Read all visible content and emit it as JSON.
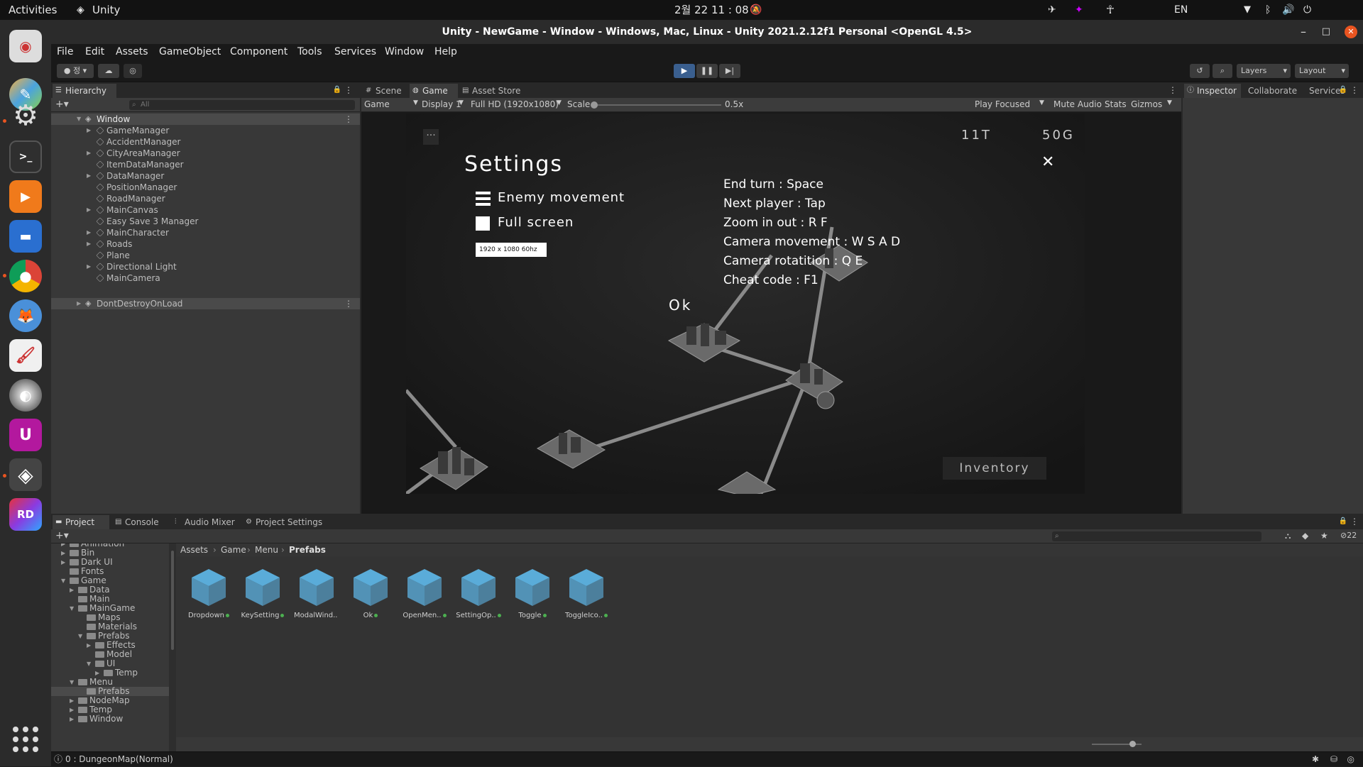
{
  "topbar": {
    "activities": "Activities",
    "app": "Unity",
    "clock": "2월 22  11 : 08",
    "lang": "EN"
  },
  "window": {
    "title": "Unity - NewGame - Window - Windows, Mac, Linux - Unity 2021.2.12f1 Personal <OpenGL 4.5>",
    "min": "–",
    "max": "□",
    "close": "✕"
  },
  "menu": [
    "File",
    "Edit",
    "Assets",
    "GameObject",
    "Component",
    "Tools",
    "Services",
    "Window",
    "Help"
  ],
  "toolbar": {
    "account": "정",
    "layers": "Layers",
    "layout": "Layout"
  },
  "hierarchy": {
    "tab": "Hierarchy",
    "search_placeholder": "All",
    "root": "Window",
    "items": [
      "GameManager",
      "AccidentManager",
      "CityAreaManager",
      "ItemDataManager",
      "DataManager",
      "PositionManager",
      "RoadManager",
      "MainCanvas",
      "Easy Save 3 Manager",
      "MainCharacter",
      "Roads",
      "Plane",
      "Directional Light",
      "MainCamera"
    ],
    "dont_destroy": "DontDestroyOnLoad"
  },
  "center_tabs": [
    "Scene",
    "Game",
    "Asset Store"
  ],
  "game_toolbar": {
    "view": "Game",
    "display": "Display 1",
    "resolution": "Full HD (1920x1080)",
    "scale_label": "Scale",
    "scale_value": "0.5x",
    "play_focused": "Play Focused",
    "mute": "Mute Audio",
    "stats": "Stats",
    "gizmos": "Gizmos"
  },
  "game": {
    "dots": "···",
    "turn": "11T",
    "gold": "50G",
    "title": "Settings",
    "close": "✕",
    "toggle_enemy": "Enemy movement",
    "toggle_full": "Full screen",
    "resolution": "1920 x 1080 60hz",
    "ok": "Ok",
    "keys": [
      "End turn : Space",
      "Next player : Tap",
      "Zoom in out : R F",
      "Camera movement : W S A D",
      "Camera rotatition : Q E",
      "Cheat code : F1"
    ],
    "inventory": "Inventory"
  },
  "right_tabs": [
    "Inspector",
    "Collaborate",
    "Services"
  ],
  "bottom_tabs": [
    "Project",
    "Console",
    "Audio Mixer",
    "Project Settings"
  ],
  "badge": "22",
  "project_tree": [
    {
      "name": "Animation",
      "d": 0,
      "a": "▶"
    },
    {
      "name": "Bin",
      "d": 0,
      "a": "▶"
    },
    {
      "name": "Dark UI",
      "d": 0,
      "a": "▶"
    },
    {
      "name": "Fonts",
      "d": 0,
      "a": ""
    },
    {
      "name": "Game",
      "d": 0,
      "a": "▼"
    },
    {
      "name": "Data",
      "d": 1,
      "a": "▶"
    },
    {
      "name": "Main",
      "d": 1,
      "a": ""
    },
    {
      "name": "MainGame",
      "d": 1,
      "a": "▼"
    },
    {
      "name": "Maps",
      "d": 2,
      "a": ""
    },
    {
      "name": "Materials",
      "d": 2,
      "a": ""
    },
    {
      "name": "Prefabs",
      "d": 2,
      "a": "▼"
    },
    {
      "name": "Effects",
      "d": 3,
      "a": "▶"
    },
    {
      "name": "Model",
      "d": 3,
      "a": ""
    },
    {
      "name": "UI",
      "d": 3,
      "a": "▼"
    },
    {
      "name": "Temp",
      "d": 4,
      "a": "▶"
    },
    {
      "name": "Menu",
      "d": 1,
      "a": "▼"
    },
    {
      "name": "Prefabs",
      "d": 2,
      "a": "",
      "sel": true
    },
    {
      "name": "NodeMap",
      "d": 1,
      "a": "▶"
    },
    {
      "name": "Temp",
      "d": 1,
      "a": "▶"
    },
    {
      "name": "Window",
      "d": 1,
      "a": "▶"
    }
  ],
  "breadcrumb": [
    "Assets",
    "Game",
    "Menu",
    "Prefabs"
  ],
  "assets": [
    "Dropdown",
    "KeySetting",
    "ModalWind..",
    "Ok",
    "OpenMen..",
    "SettingOp..",
    "Toggle",
    "ToggleIco.."
  ],
  "status": "0 : DungeonMap(Normal)",
  "colors": {
    "accent": "#e95420",
    "asset_cube": "#5db3e3",
    "play_active": "#3a5f8f"
  }
}
